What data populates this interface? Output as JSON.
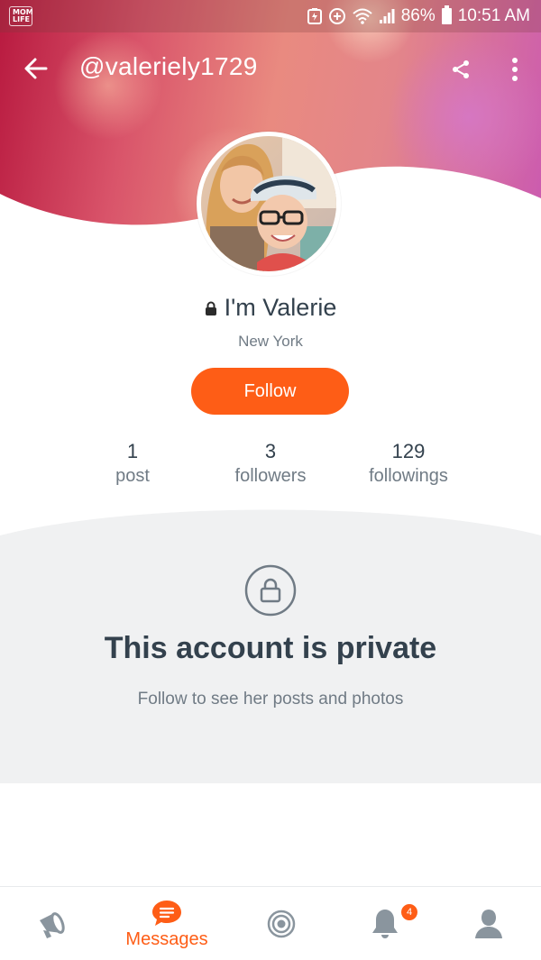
{
  "status_bar": {
    "app_badge_line1": "MOM",
    "app_badge_line2": "LIFE",
    "battery_percent": "86%",
    "time": "10:51 AM"
  },
  "toolbar": {
    "handle": "@valeriely1729"
  },
  "profile": {
    "name": "I'm Valerie",
    "location": "New York",
    "follow_label": "Follow",
    "stats": [
      {
        "value": "1",
        "label": "post"
      },
      {
        "value": "3",
        "label": "followers"
      },
      {
        "value": "129",
        "label": "followings"
      }
    ]
  },
  "private_notice": {
    "title": "This account is private",
    "subtitle": "Follow to see her posts and photos"
  },
  "bottom_nav": {
    "messages_label": "Messages",
    "notifications_count": "4"
  },
  "colors": {
    "accent": "#fe5d16",
    "text_dark": "#33414d",
    "text_muted": "#707b85",
    "panel_bg": "#f0f1f2",
    "icon_gray": "#8a959e"
  }
}
